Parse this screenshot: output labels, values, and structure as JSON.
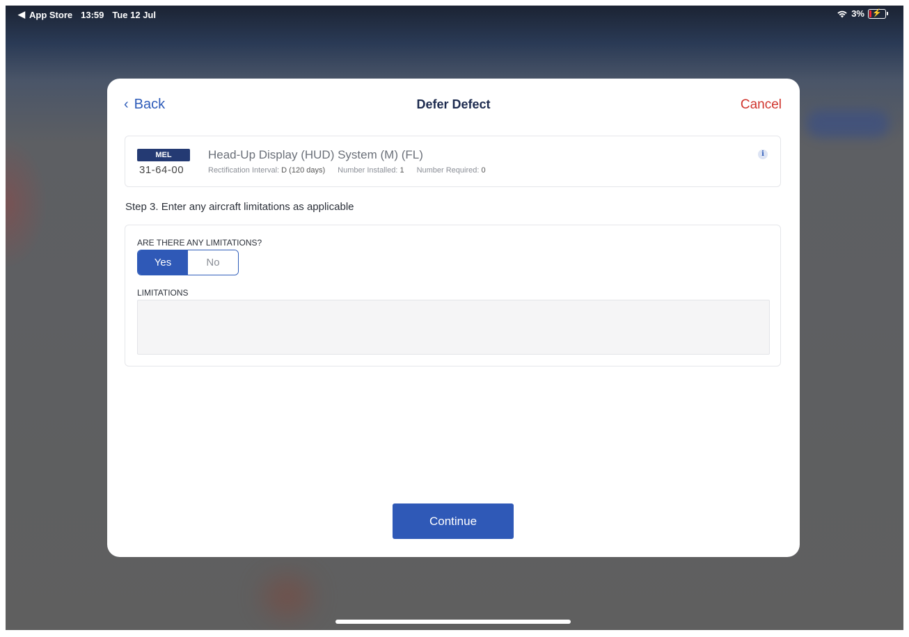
{
  "status_bar": {
    "back_app": "App Store",
    "time": "13:59",
    "date": "Tue 12 Jul",
    "battery": "3%"
  },
  "header": {
    "back_label": "Back",
    "title": "Defer Defect",
    "cancel_label": "Cancel"
  },
  "mel": {
    "badge": "MEL",
    "code": "31-64-00",
    "title": "Head-Up Display (HUD) System (M) (FL)",
    "rect_interval_label": "Rectification Interval:",
    "rect_interval_value": "D (120 days)",
    "installed_label": "Number Installed:",
    "installed_value": "1",
    "required_label": "Number Required:",
    "required_value": "0"
  },
  "step": {
    "label": "Step 3. Enter any aircraft limitations as applicable"
  },
  "limitations": {
    "question": "ARE THERE ANY LIMITATIONS?",
    "yes_label": "Yes",
    "no_label": "No",
    "selected": "Yes",
    "field_label": "LIMITATIONS",
    "field_value": ""
  },
  "footer": {
    "continue_label": "Continue"
  },
  "colors": {
    "accent": "#2f59b7",
    "cancel": "#d0342c",
    "badge": "#243a73"
  }
}
